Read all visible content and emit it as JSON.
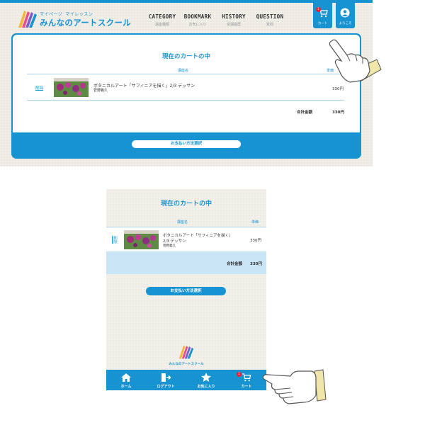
{
  "desktop": {
    "logo": {
      "sub_left": "マイページ",
      "sub_right": "マイレッスン",
      "title": "みんなのアートスクール"
    },
    "nav": [
      {
        "en": "CATEGORY",
        "jp": "講座種類"
      },
      {
        "en": "BOOKMARK",
        "jp": "お気に入り"
      },
      {
        "en": "HISTORY",
        "jp": "受講履歴"
      },
      {
        "en": "QUESTION",
        "jp": "質問"
      }
    ],
    "cart_button": {
      "label": "カート",
      "badge": "1"
    },
    "user_button": {
      "label": "ようこそ"
    },
    "cart": {
      "title": "現在のカートの中",
      "col_name": "講座名",
      "col_price": "単価",
      "item": {
        "delete_label": "削除",
        "title": "ボタニカルアート「サフィニアを描く」2/3 デッサン",
        "author": "菅野義久",
        "price": "330円"
      },
      "total_label": "合計金額",
      "total_value": "330円",
      "pay_button": "お支払い方法選択"
    }
  },
  "mobile": {
    "cart": {
      "title": "現在のカートの中",
      "col_name": "講座名",
      "col_price": "単価",
      "item": {
        "delete_label": "削除",
        "title_line1": "ボタニカルアート「サフィニアを描く」",
        "title_line2": "2/3 デッサン",
        "author": "菅野義久",
        "price": "330円"
      },
      "total_label": "合計金額",
      "total_value": "330円",
      "pay_button": "お支払い方法選択"
    },
    "footer_logo": "みんなのアートスクール",
    "nav": [
      {
        "label": "ホーム",
        "icon": "home-icon"
      },
      {
        "label": "ログアウト",
        "icon": "logout-icon"
      },
      {
        "label": "お気に入り",
        "icon": "star-icon"
      },
      {
        "label": "カート",
        "icon": "cart-icon",
        "badge": "1"
      }
    ]
  },
  "colors": {
    "brand": "#1793d1",
    "light_blue": "#c9e4f4",
    "badge": "#e6222d",
    "background": "#f1ede7"
  }
}
